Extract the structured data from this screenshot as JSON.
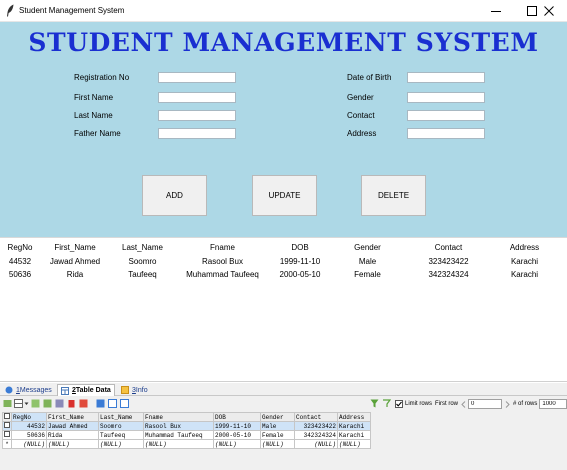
{
  "window": {
    "title": "Student Management System",
    "controls": {
      "minimize": "—",
      "maximize": "☐",
      "close": "✕"
    }
  },
  "form": {
    "heading": "STUDENT MANAGEMENT SYSTEM",
    "labels": {
      "registration_no": "Registration No",
      "first_name": "First Name",
      "last_name": "Last Name",
      "father_name": "Father Name",
      "date_of_birth": "Date of Birth",
      "gender": "Gender",
      "contact": "Contact",
      "address": "Address"
    },
    "values": {
      "registration_no": "",
      "first_name": "",
      "last_name": "",
      "father_name": "",
      "date_of_birth": "",
      "gender": "",
      "contact": "",
      "address": ""
    },
    "buttons": {
      "add": "ADD",
      "update": "UPDATE",
      "delete": "DELETE"
    }
  },
  "records": {
    "columns": [
      "RegNo",
      "First_Name",
      "Last_Name",
      "Fname",
      "DOB",
      "Gender",
      "Contact",
      "Address"
    ],
    "rows": [
      [
        "44532",
        "Jawad Ahmed",
        "Soomro",
        "Rasool Bux",
        "1999-11-10",
        "Male",
        "323423422",
        "Karachi"
      ],
      [
        "50636",
        "Rida",
        "Taufeeq",
        "Muhammad Taufeeq",
        "2000-05-10",
        "Female",
        "342324324",
        "Karachi"
      ]
    ]
  },
  "panel": {
    "tabs": [
      {
        "num": "1",
        "label": " Messages"
      },
      {
        "num": "2",
        "label": " Table Data"
      },
      {
        "num": "3",
        "label": " Info"
      }
    ],
    "toolbar": {
      "limit_rows": "Limit rows",
      "first_row": "First row",
      "first_row_value": "0",
      "num_rows": "# of rows",
      "num_rows_value": "1000"
    },
    "grid": {
      "columns": [
        "RegNo",
        "First_Name",
        "Last_Name",
        "Fname",
        "DOB",
        "Gender",
        "Contact",
        "Address"
      ],
      "rows": [
        [
          "44532",
          "Jawad Ahmed",
          "Soomro",
          "Rasool Bux",
          "1999-11-10",
          "Male",
          "323423422",
          "Karachi"
        ],
        [
          "50636",
          "Rida",
          "Taufeeq",
          "Muhammad Taufeeq",
          "2000-05-10",
          "Female",
          "342324324",
          "Karachi"
        ],
        [
          "(NULL)",
          "(NULL)",
          "(NULL)",
          "(NULL)",
          "(NULL)",
          "(NULL)",
          "(NULL)",
          "(NULL)"
        ]
      ],
      "new_row_marker": "*"
    }
  },
  "colors": {
    "form_background": "#add8e6",
    "heading": "#1a2fd1",
    "selected_row": "#cfe3f7"
  }
}
